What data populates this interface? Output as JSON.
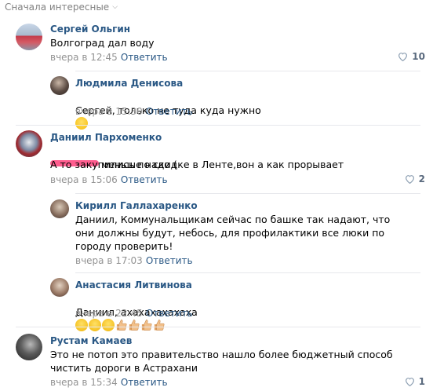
{
  "sort": {
    "label": "Сначала интересные"
  },
  "comments": [
    {
      "author": "Сергей Ольгин",
      "text": "Волгоград дал воду",
      "time": "вчера в 12:45",
      "reply": "Ответить",
      "likes": "10"
    },
    {
      "author": "Людмила Денисова",
      "text": "Сергей, только не туда куда нужно",
      "time": "вчера в 15:30",
      "reply": "Ответить"
    },
    {
      "author": "Даниил Пархоменко",
      "text1": "меньше надо (",
      "text2": "А то закупились по скидке в Ленте,вон а как прорывает",
      "time": "вчера в 15:06",
      "reply": "Ответить",
      "likes": "2"
    },
    {
      "author": "Кирилл Галлахаренко",
      "text": "Даниил, Коммунальщикам сейчас по башке так надают, что они должны будут, небось, для профилактики все люки по городу проверить!",
      "time": "вчера в 17:03",
      "reply": "Ответить"
    },
    {
      "author": "Анастасия Литвинова",
      "text": "Даниил, ахахахахахаха",
      "time": "вчера в 22:45",
      "reply": "Ответить"
    },
    {
      "author": "Рустам Камаев",
      "text": "Это не потоп это правительство нашло более бюджетный способ чистить дороги в Астрахани",
      "time": "вчера в 15:34",
      "reply": "Ответить",
      "likes": "1"
    }
  ],
  "colors": {
    "link": "#2a5885",
    "meta": "#939393",
    "divider": "#e7e8ec"
  }
}
